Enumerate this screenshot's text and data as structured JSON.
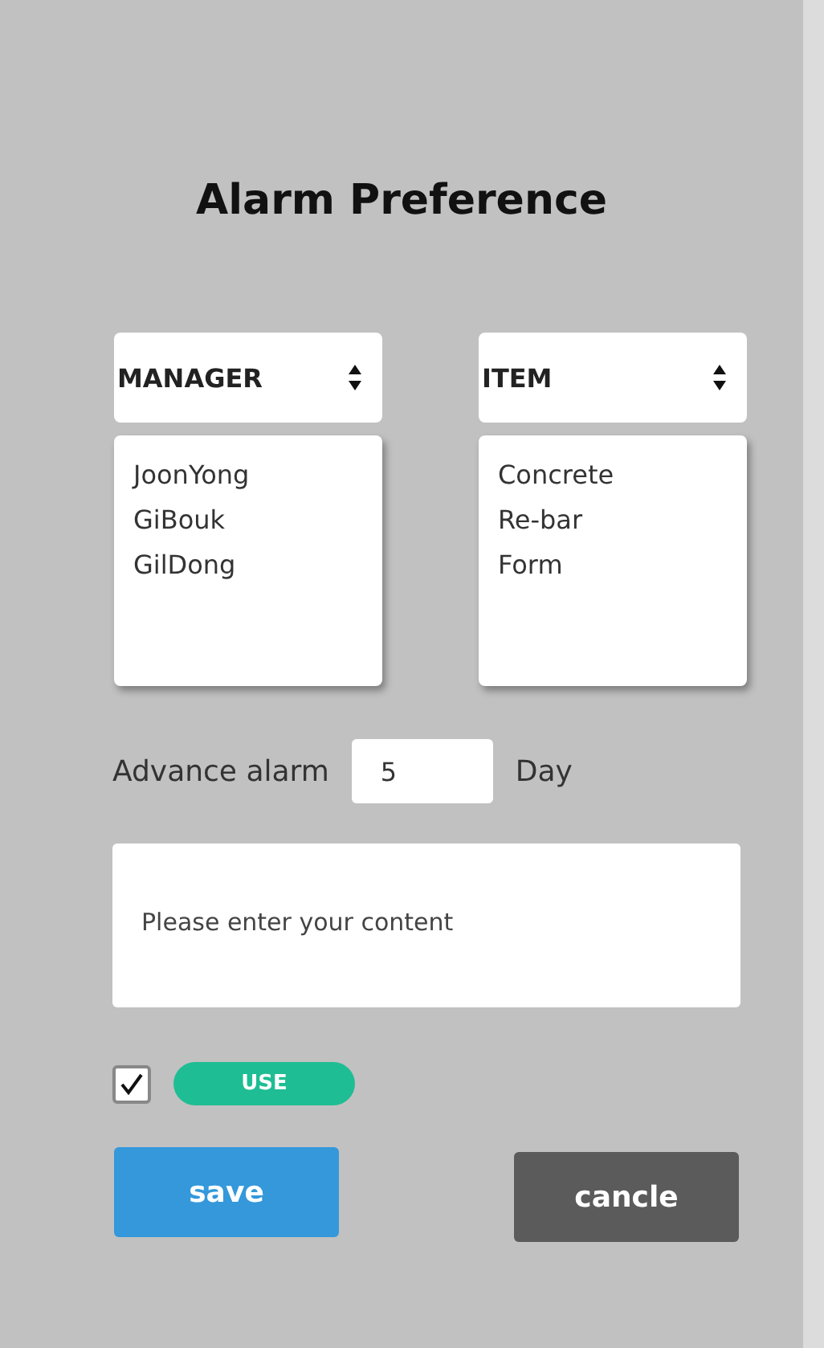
{
  "title": "Alarm Preference",
  "selects": [
    {
      "label": "MANAGER",
      "options": [
        "JoonYong",
        "GiBouk",
        "GilDong"
      ]
    },
    {
      "label": "ITEM",
      "options": [
        "Concrete",
        "Re-bar",
        "Form"
      ]
    }
  ],
  "advance": {
    "label": "Advance alarm",
    "value": "5",
    "unit": "Day"
  },
  "content": {
    "placeholder": "Please enter your content"
  },
  "use": {
    "checked": true,
    "label": "USE"
  },
  "buttons": [
    {
      "kind": "primary",
      "label": "save"
    },
    {
      "kind": "secondary",
      "label": "cancle"
    }
  ]
}
